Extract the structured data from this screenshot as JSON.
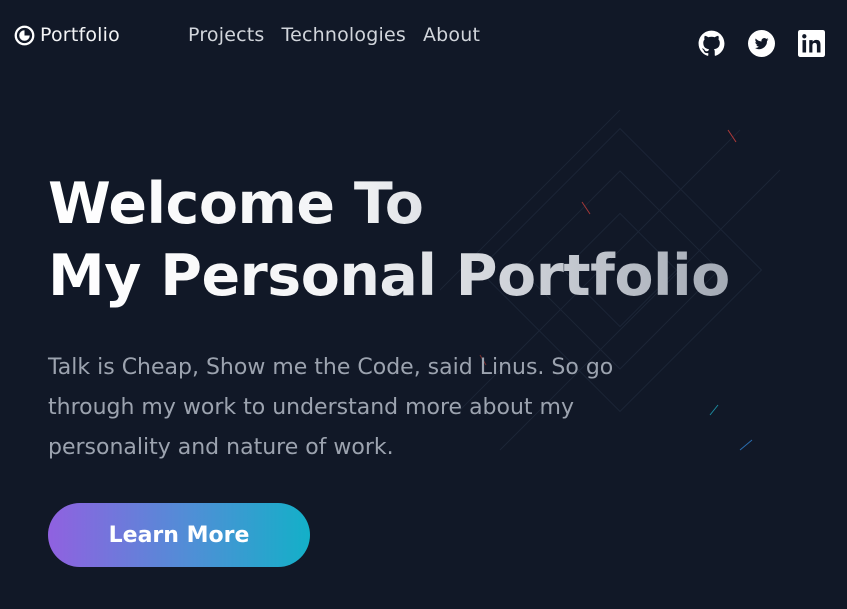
{
  "nav": {
    "logo_text": "Portfolio",
    "links": [
      {
        "label": "Projects"
      },
      {
        "label": "Technologies"
      },
      {
        "label": "About"
      }
    ],
    "social": [
      {
        "icon": "github-icon"
      },
      {
        "icon": "twitter-icon"
      },
      {
        "icon": "linkedin-icon"
      }
    ]
  },
  "hero": {
    "title_line1": "Welcome To",
    "title_line2": "My Personal Portfolio",
    "description": "Talk is Cheap, Show me the Code, said Linus. So go through my work to understand more about my personality and nature of work.",
    "cta_label": "Learn More"
  },
  "colors": {
    "background": "#111827",
    "nav_text": "#d1d5db",
    "body_text": "#9ca3af",
    "button_gradient_start": "#9061e0",
    "button_gradient_end": "#13b0c8"
  }
}
